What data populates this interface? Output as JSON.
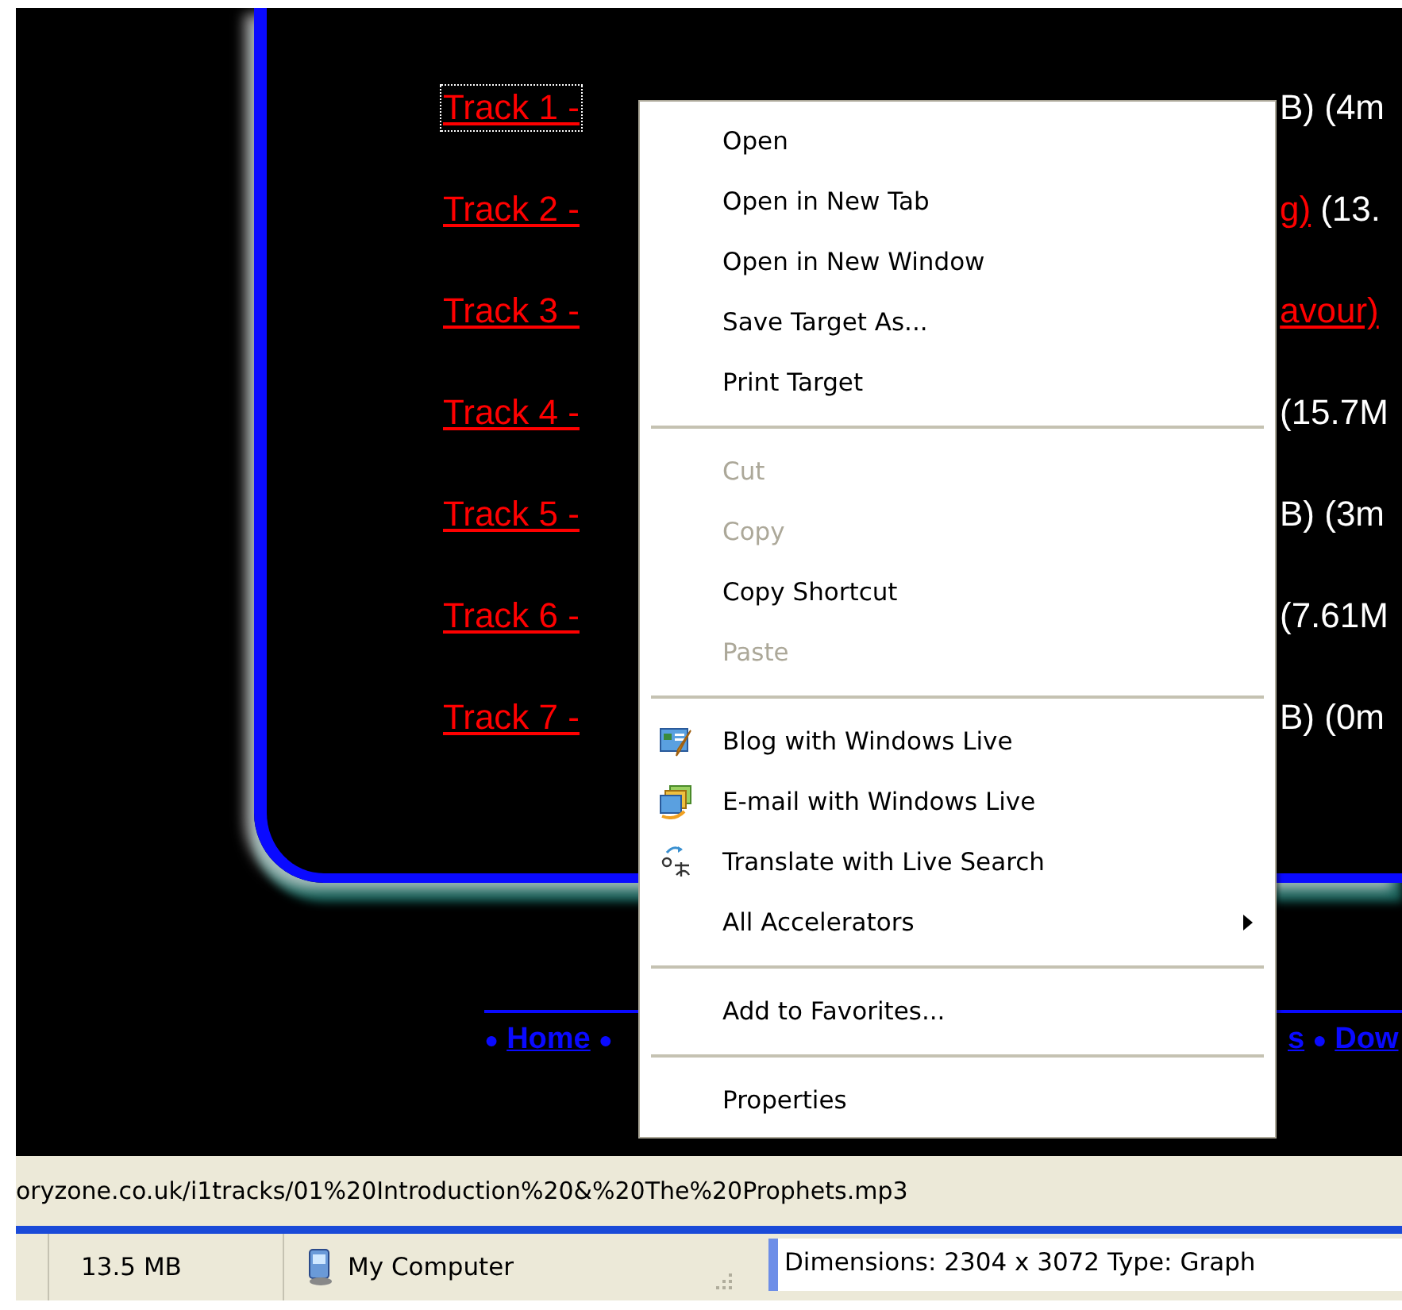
{
  "page": {
    "tracks": [
      {
        "link_start": "Track 1 -",
        "info": "B) (4m",
        "focused": true
      },
      {
        "link_start": "Track 2 -",
        "link_end": "g)",
        "info": "(13.",
        "focused": false
      },
      {
        "link_start": "Track 3 -",
        "link_end": "avour)",
        "focused": false
      },
      {
        "link_start": "Track 4 -",
        "info": "(15.7M",
        "focused": false
      },
      {
        "link_start": "Track 5 -",
        "info": "B) (3m",
        "focused": false
      },
      {
        "link_start": "Track 6 -",
        "info": "(7.61M",
        "focused": false
      },
      {
        "link_start": "Track 7 -",
        "info": "B) (0m",
        "focused": false
      }
    ],
    "nav": {
      "bullet": "●",
      "left_link": "Home",
      "right_fragment": "s",
      "right_link": "Dow"
    }
  },
  "context_menu": [
    {
      "kind": "item",
      "label": "Open",
      "disabled": false
    },
    {
      "kind": "item",
      "label": "Open in New Tab",
      "disabled": false
    },
    {
      "kind": "item",
      "label": "Open in New Window",
      "disabled": false
    },
    {
      "kind": "item",
      "label": "Save Target As...",
      "disabled": false
    },
    {
      "kind": "item",
      "label": "Print Target",
      "disabled": false
    },
    {
      "kind": "separator"
    },
    {
      "kind": "item",
      "label": "Cut",
      "disabled": true
    },
    {
      "kind": "item",
      "label": "Copy",
      "disabled": true
    },
    {
      "kind": "item",
      "label": "Copy Shortcut",
      "disabled": false
    },
    {
      "kind": "item",
      "label": "Paste",
      "disabled": true
    },
    {
      "kind": "separator"
    },
    {
      "kind": "item",
      "label": "Blog with Windows Live",
      "disabled": false
    },
    {
      "kind": "item",
      "label": "E-mail with Windows Live",
      "disabled": false
    },
    {
      "kind": "item",
      "label": "Translate with Live Search",
      "disabled": false
    },
    {
      "kind": "item",
      "label": "All Accelerators",
      "disabled": false,
      "submenu": true
    },
    {
      "kind": "separator"
    },
    {
      "kind": "item",
      "label": "Add to Favorites...",
      "disabled": false
    },
    {
      "kind": "separator"
    },
    {
      "kind": "item",
      "label": "Properties",
      "disabled": false
    }
  ],
  "link_url": "oryzone.co.uk/i1tracks/01%20Introduction%20&%20The%20Prophets.mp3",
  "status_bar": {
    "size": "13.5 MB",
    "zone": "My Computer",
    "extra": "Dimensions: 2304 x 3072 Type: Graph"
  }
}
